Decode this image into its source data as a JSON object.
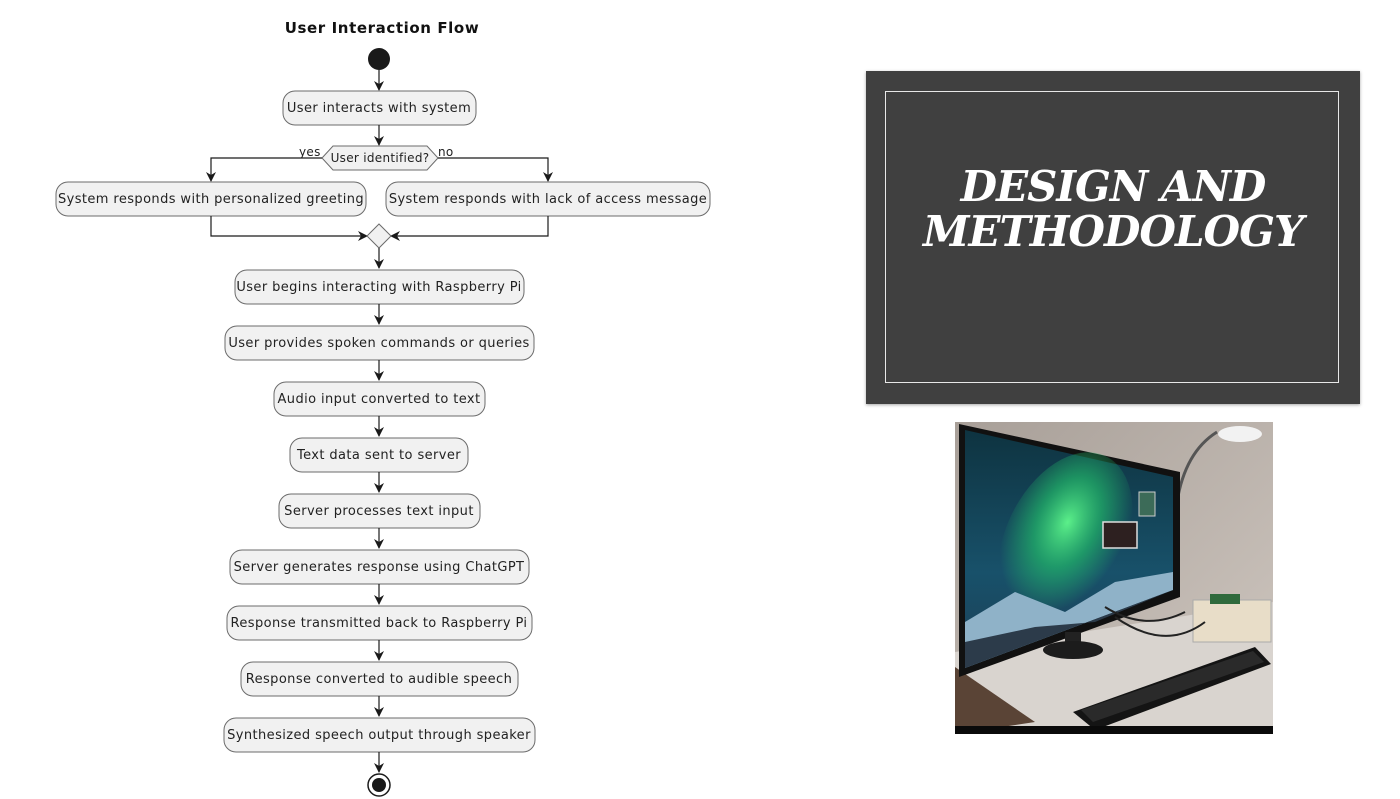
{
  "diagram": {
    "title": "User Interaction Flow",
    "decision": {
      "question": "User identified?",
      "yes_label": "yes",
      "no_label": "no",
      "yes_action": "System responds with personalized greeting",
      "no_action": "System responds with lack of access message"
    },
    "steps": [
      "User interacts with system",
      "User begins interacting with Raspberry Pi",
      "User provides spoken commands or queries",
      "Audio input converted to text",
      "Text data sent to server",
      "Server processes text input",
      "Server generates response using ChatGPT",
      "Response transmitted back to Raspberry Pi",
      "Response converted to audible speech",
      "Synthesized speech output through speaker"
    ]
  },
  "slide": {
    "title_line1": "DESIGN AND",
    "title_line2": "METHODOLOGY"
  },
  "colors": {
    "node_fill": "#f1f1f1",
    "node_stroke": "#6b6b6b",
    "slide_bg": "#404040"
  },
  "photo": {
    "subject": "desktop-monitor-keyboard-raspberry-pi-photo"
  }
}
